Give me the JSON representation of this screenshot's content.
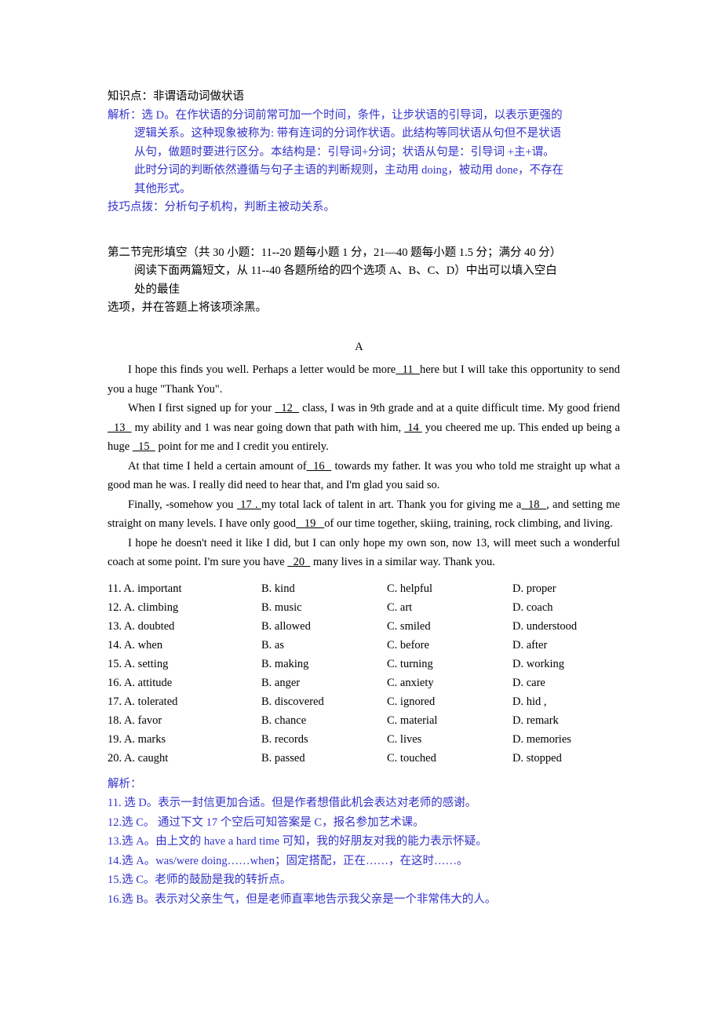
{
  "document": {
    "type": "exam-answer-key",
    "accent_blue": "#3333cc",
    "text_black": "#000000"
  },
  "analysis_block": {
    "knowledge_point": "知识点：非谓语动词做状语",
    "explanation_lines": [
      "解析：选 D。在作状语的分词前常可加一个时间，条件，让步状语的引导词，以表示更强的",
      "逻辑关系。这种现象被称为: 带有连词的分词作状语。此结构等同状语从句但不是状语",
      "从句，做题时要进行区分。本结构是：引导词+分词；状语从句是：引导词 +主+谓。",
      "此时分词的判断依然遵循与句子主语的判断规则，主动用 doing，被动用 done，不存在",
      "其他形式。"
    ],
    "tip_line": "技巧点拨：分析句子机构，判断主被动关系。"
  },
  "section_heading": {
    "line1": "第二节完形填空（共 30 小题：11--20 题每小题 1 分，21—40 题每小题 1.5 分；满分 40 分）",
    "line2": "阅读下面两篇短文，从 11--40 各题所给的四个选项 A、B、C、D）中出可以填入空白",
    "line3": "处的最佳",
    "line4": "选项，并在答题上将该项涂黑。"
  },
  "passage": {
    "label": "A",
    "paragraphs": [
      {
        "indent": true,
        "segments": [
          {
            "kind": "text",
            "value": "I hope this finds you well. Perhaps a letter would be more"
          },
          {
            "kind": "blank",
            "value": "  11  "
          },
          {
            "kind": "text",
            "value": "here but I will take this opportunity to send you a huge \"Thank You\"."
          }
        ]
      },
      {
        "indent": true,
        "segments": [
          {
            "kind": "text",
            "value": "When I first signed up for your "
          },
          {
            "kind": "blank",
            "value": "  12  "
          },
          {
            "kind": "text",
            "value": " class, I was in 9th grade and at a quite difficult time. My good friend "
          },
          {
            "kind": "blank",
            "value": "  13  "
          },
          {
            "kind": "text",
            "value": " my ability and 1 was near going down that path with him, "
          },
          {
            "kind": "blank",
            "value": " 14 "
          },
          {
            "kind": "text",
            "value": " you cheered me up. This ended up being a huge "
          },
          {
            "kind": "blank",
            "value": "  15  "
          },
          {
            "kind": "text",
            "value": " point for me and I credit you entirely."
          }
        ]
      },
      {
        "indent": true,
        "segments": [
          {
            "kind": "text",
            "value": "At that time I held a certain amount of"
          },
          {
            "kind": "blank",
            "value": "  16  "
          },
          {
            "kind": "text",
            "value": " towards my father. It was you who told me straight up what a good man he was. I really did need to hear that, and I'm glad you said so."
          }
        ]
      },
      {
        "indent": true,
        "segments": [
          {
            "kind": "text",
            "value": "Finally, -somehow you "
          },
          {
            "kind": "blank",
            "value": " 17 . "
          },
          {
            "kind": "text",
            "value": "my total lack of talent in art. Thank you for giving me a"
          },
          {
            "kind": "blank",
            "value": "  18  "
          },
          {
            "kind": "text",
            "value": ", and setting me straight on many levels. I have only good"
          },
          {
            "kind": "blank",
            "value": "   19   "
          },
          {
            "kind": "text",
            "value": "of our time together, skiing, training, rock climbing, and living."
          }
        ]
      },
      {
        "indent": true,
        "segments": [
          {
            "kind": "text",
            "value": "I hope he doesn't need it like I did, but I can only hope my own son, now 13, will meet such a wonderful coach at some point. I'm sure you have "
          },
          {
            "kind": "blank",
            "value": "  20  "
          },
          {
            "kind": "text",
            "value": "  many lives in a similar way. Thank you."
          }
        ]
      }
    ]
  },
  "options": {
    "rows": [
      {
        "number": "11.",
        "a": "A. important",
        "b": "B. kind",
        "c": "C. helpful",
        "d": "D. proper"
      },
      {
        "number": "12.",
        "a": "A. climbing",
        "b": "B. music",
        "c": "C. art",
        "d": "D. coach"
      },
      {
        "number": "13.",
        "a": "A. doubted",
        "b": "B. allowed",
        "c": "C. smiled",
        "d": "D. understood"
      },
      {
        "number": "14.",
        "a": "A. when",
        "b": "B. as",
        "c": "C. before",
        "d": "D. after"
      },
      {
        "number": "15.",
        "a": "A. setting",
        "b": "B. making",
        "c": "C. turning",
        "d": "D. working"
      },
      {
        "number": "16.",
        "a": "A. attitude",
        "b": "B. anger",
        "c": "C. anxiety",
        "d": "D. care"
      },
      {
        "number": "17.",
        "a": "A. tolerated",
        "b": "B. discovered",
        "c": "C. ignored",
        "d": "D. hid ,"
      },
      {
        "number": "18.",
        "a": "A. favor",
        "b": "B. chance",
        "c": "C. material",
        "d": "D. remark"
      },
      {
        "number": "19.",
        "a": "A. marks",
        "b": "B. records",
        "c": "C. lives",
        "d": "D. memories"
      },
      {
        "number": "20.",
        "a": "A. caught",
        "b": "B. passed",
        "c": "C. touched",
        "d": "D. stopped"
      }
    ]
  },
  "explanations": {
    "heading": "解析：",
    "items": [
      "11. 选 D。表示一封信更加合适。但是作者想借此机会表达对老师的感谢。",
      "12.选 C。 通过下文 17 个空后可知答案是 C，报名参加艺术课。",
      "13.选 A。由上文的 have a hard time 可知，我的好朋友对我的能力表示怀疑。",
      "14.选 A。was/were doing……when；固定搭配，正在……，在这时……。",
      "15.选 C。老师的鼓励是我的转折点。",
      "16.选 B。表示对父亲生气，但是老师直率地告示我父亲是一个非常伟大的人。"
    ]
  }
}
